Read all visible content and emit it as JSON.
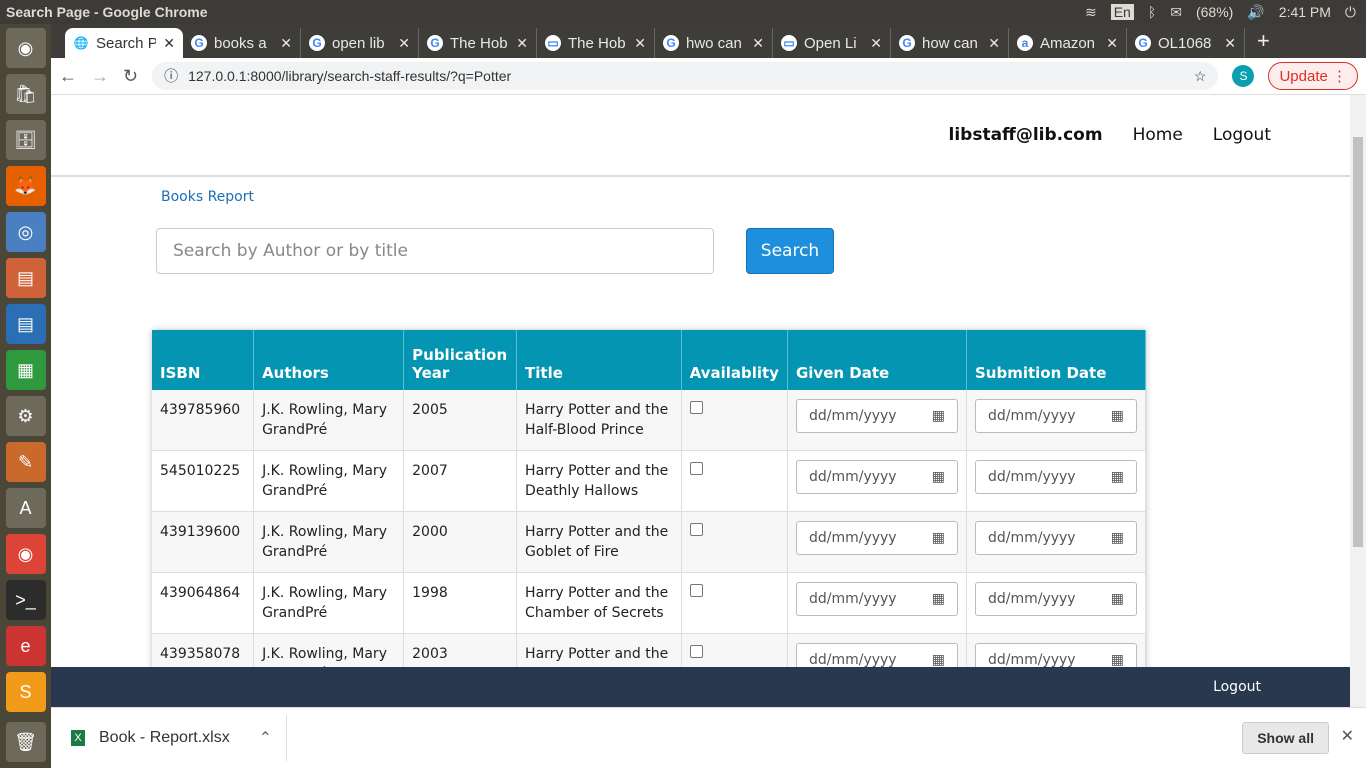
{
  "os": {
    "window_title": "Search Page - Google Chrome",
    "lang": "En",
    "battery": "(68%)",
    "time": "2:41 PM"
  },
  "tabs": [
    {
      "label": "Search Page",
      "icon": "globe-icon"
    },
    {
      "label": "books a",
      "icon": "google-icon"
    },
    {
      "label": "open lib",
      "icon": "google-icon"
    },
    {
      "label": "The Hob",
      "icon": "google-icon"
    },
    {
      "label": "The Hob",
      "icon": "openlibrary-icon"
    },
    {
      "label": "hwo can",
      "icon": "google-icon"
    },
    {
      "label": "Open Li",
      "icon": "openlibrary-icon"
    },
    {
      "label": "how can",
      "icon": "google-icon"
    },
    {
      "label": "Amazon",
      "icon": "amazon-icon"
    },
    {
      "label": "OL1068",
      "icon": "google-icon"
    }
  ],
  "toolbar": {
    "url": "127.0.0.1:8000/library/search-staff-results/?q=Potter",
    "avatar": "S",
    "update": "Update"
  },
  "nav": {
    "user": "libstaff@lib.com",
    "home": "Home",
    "logout": "Logout"
  },
  "breadcrumb": "Books Report",
  "search": {
    "placeholder": "Search by Author or by title",
    "button": "Search"
  },
  "table": {
    "headers": [
      "ISBN",
      "Authors",
      "Publication Year",
      "Title",
      "Availablity",
      "Given Date",
      "Submition Date"
    ],
    "rows": [
      {
        "isbn": "439785960",
        "authors": "J.K. Rowling, Mary GrandPré",
        "year": "2005",
        "title": "Harry Potter and the Half-Blood Prince"
      },
      {
        "isbn": "545010225",
        "authors": "J.K. Rowling, Mary GrandPré",
        "year": "2007",
        "title": "Harry Potter and the Deathly Hallows"
      },
      {
        "isbn": "439139600",
        "authors": "J.K. Rowling, Mary GrandPré",
        "year": "2000",
        "title": "Harry Potter and the Goblet of Fire"
      },
      {
        "isbn": "439064864",
        "authors": "J.K. Rowling, Mary GrandPré",
        "year": "1998",
        "title": "Harry Potter and the Chamber of Secrets"
      },
      {
        "isbn": "439358078",
        "authors": "J.K. Rowling, Mary GrandPré",
        "year": "2003",
        "title": "Harry Potter and the Order of the Phoenix"
      }
    ],
    "date_placeholder": "dd/mm/yyyy"
  },
  "footer": {
    "logout": "Logout"
  },
  "download": {
    "file": "Book - Report.xlsx",
    "show_all": "Show all"
  }
}
